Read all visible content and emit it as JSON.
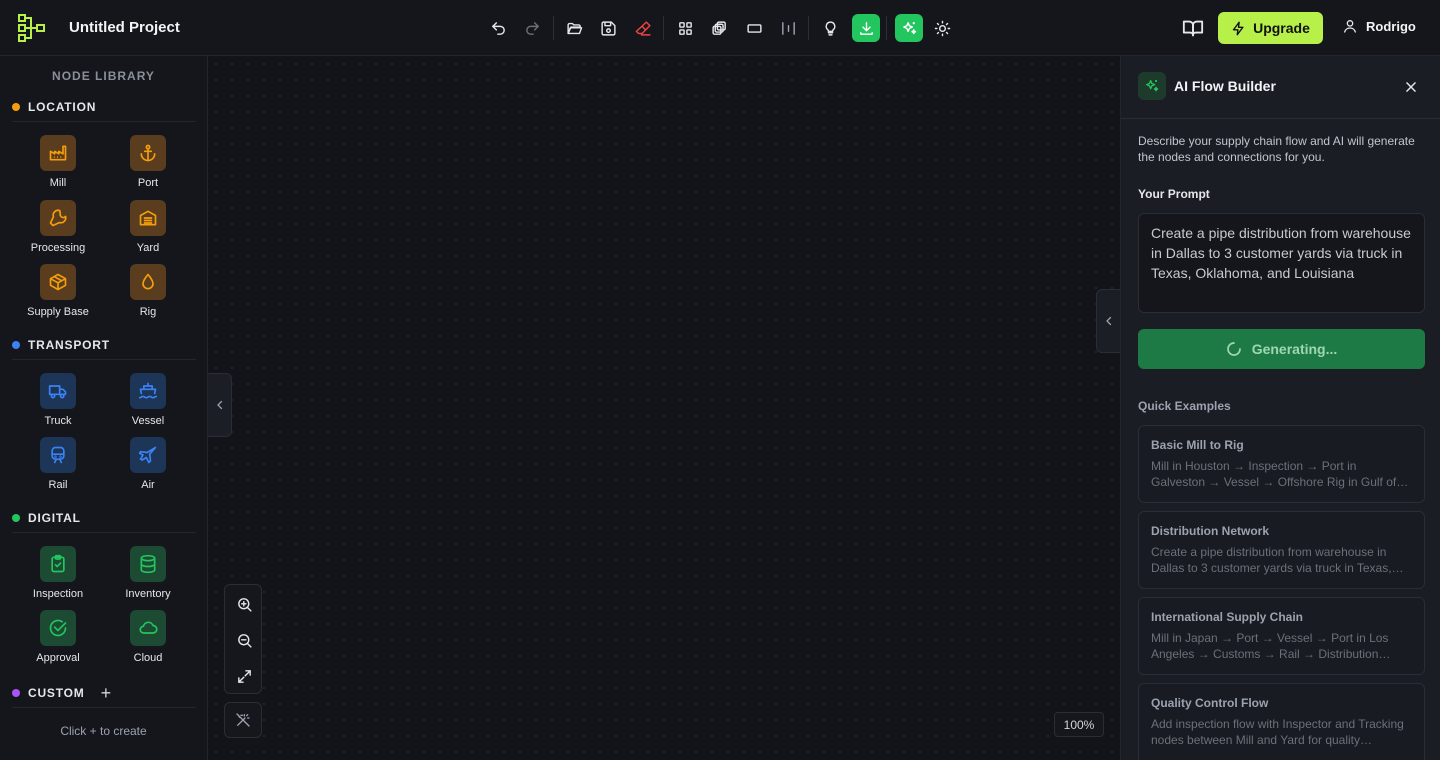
{
  "header": {
    "project_title": "Untitled Project",
    "upgrade_label": "Upgrade",
    "user_name": "Rodrigo"
  },
  "sidebar": {
    "title": "NODE LIBRARY",
    "categories": [
      {
        "name": "LOCATION",
        "color": "#f59e0b",
        "items": [
          {
            "label": "Mill",
            "icon": "factory-icon"
          },
          {
            "label": "Port",
            "icon": "anchor-icon"
          },
          {
            "label": "Processing",
            "icon": "wrench-icon"
          },
          {
            "label": "Yard",
            "icon": "warehouse-icon"
          },
          {
            "label": "Supply Base",
            "icon": "box-icon"
          },
          {
            "label": "Rig",
            "icon": "droplet-icon"
          }
        ]
      },
      {
        "name": "TRANSPORT",
        "color": "#3b82f6",
        "items": [
          {
            "label": "Truck",
            "icon": "truck-icon"
          },
          {
            "label": "Vessel",
            "icon": "ship-icon"
          },
          {
            "label": "Rail",
            "icon": "train-icon"
          },
          {
            "label": "Air",
            "icon": "plane-icon"
          }
        ]
      },
      {
        "name": "DIGITAL",
        "color": "#22c55e",
        "items": [
          {
            "label": "Inspection",
            "icon": "clipboard-check-icon"
          },
          {
            "label": "Inventory",
            "icon": "database-icon"
          },
          {
            "label": "Approval",
            "icon": "check-circle-icon"
          },
          {
            "label": "Cloud",
            "icon": "cloud-icon"
          }
        ]
      },
      {
        "name": "CUSTOM",
        "color": "#a855f7",
        "items": []
      }
    ],
    "custom_hint": "Click + to create"
  },
  "canvas": {
    "zoom_level": "100%"
  },
  "ai_panel": {
    "title": "AI Flow Builder",
    "description": "Describe your supply chain flow and AI will generate the nodes and connections for you.",
    "prompt_label": "Your Prompt",
    "prompt_value": "Create a pipe distribution from warehouse in Dallas to 3 customer yards via truck in Texas, Oklahoma, and Louisiana",
    "generate_label": "Generating...",
    "quick_examples_label": "Quick Examples",
    "examples": [
      {
        "title": "Basic Mill to Rig",
        "desc": "Mill in Houston → Inspection → Port in Galveston → Vessel → Offshore Rig in Gulf of Mexico"
      },
      {
        "title": "Distribution Network",
        "desc": "Create a pipe distribution from warehouse in Dallas to 3 customer yards via truck in Texas, Oklahoma, and Louisiana"
      },
      {
        "title": "International Supply Chain",
        "desc": "Mill in Japan → Port → Vessel → Port in Los Angeles → Customs → Rail → Distribution Center"
      },
      {
        "title": "Quality Control Flow",
        "desc": "Add inspection flow with Inspector and Tracking nodes between Mill and Yard for quality assurance"
      }
    ]
  },
  "colors": {
    "accent_lime": "#b8f04a",
    "accent_green": "#22c55e",
    "danger_red": "#ef4444"
  }
}
